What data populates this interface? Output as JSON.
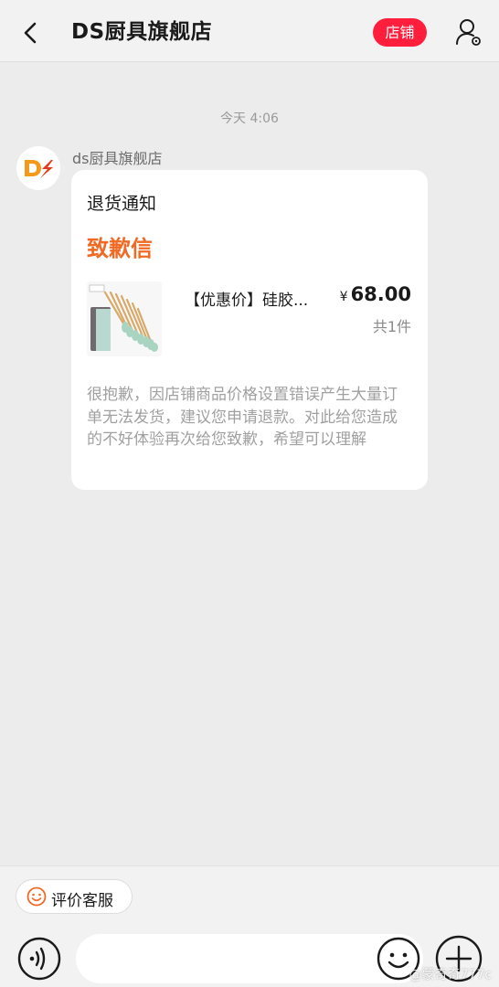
{
  "header": {
    "title": "DS厨具旗舰店",
    "shop_label": "店铺"
  },
  "chat": {
    "timestamp": "今天 4:06",
    "sender_name": "ds厨具旗舰店"
  },
  "card": {
    "heading": "退货通知",
    "subtitle": "致歉信",
    "product": {
      "name": "【优惠价】硅胶...",
      "currency": "¥",
      "price": "68.00",
      "quantity": "共1件"
    },
    "body": "很抱歉，因店铺商品价格设置错误产生大量订单无法发货，建议您申请退款。对此给您造成的不好体验再次给您致歉，希望可以理解"
  },
  "bottom": {
    "rate_label": "评价客服",
    "input_value": ""
  },
  "watermark": "@蒙奇奇777c",
  "colors": {
    "accent": "#ff1f3d",
    "subtitle": "#f06a24",
    "logo_orange": "#f29a1b",
    "logo_red": "#e23a1a"
  }
}
